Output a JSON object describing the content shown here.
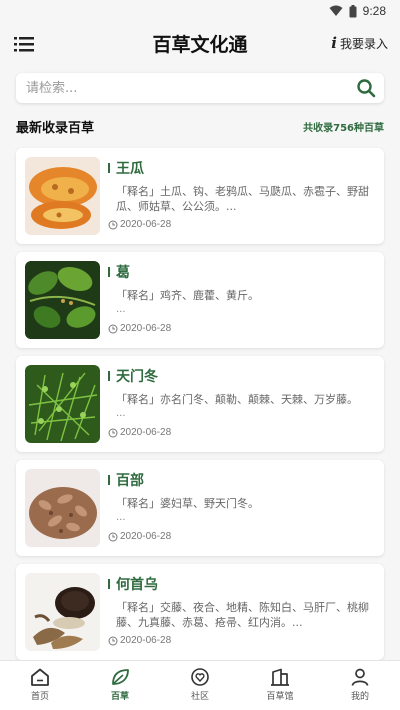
{
  "status_bar": {
    "time": "9:28"
  },
  "app_bar": {
    "title": "百草文化通",
    "contribute_label": "我要录入"
  },
  "search": {
    "placeholder": "请检索..."
  },
  "section": {
    "title": "最新收录百草",
    "count": "共收录756种百草"
  },
  "herbs": [
    {
      "name": "王瓜",
      "desc": "「释名」土瓜、钩、老鸦瓜、马瓞瓜、赤雹子、野甜瓜、师姑草、公公须。...",
      "more": "",
      "date": "2020-06-28",
      "image": "orange-gourd"
    },
    {
      "name": "葛",
      "desc": "「释名」鸡齐、鹿藿、黄斤。",
      "more": "...",
      "date": "2020-06-28",
      "image": "green-vine"
    },
    {
      "name": "天门冬",
      "desc": "「释名」亦名门冬、颠勒、颠棘、天棘、万岁藤。",
      "more": "...",
      "date": "2020-06-28",
      "image": "fern-foliage"
    },
    {
      "name": "百部",
      "desc": "「释名」婆妇草、野天门冬。",
      "more": "...",
      "date": "2020-06-28",
      "image": "dried-slices"
    },
    {
      "name": "何首乌",
      "desc": "「释名」交藤、夜合、地精、陈知白、马肝厂、桃柳藤、九真藤、赤葛、疮帚、红内消。...",
      "more": "",
      "date": "2020-06-28",
      "image": "dark-root"
    }
  ],
  "tabs": [
    {
      "label": "首页",
      "icon": "home-icon",
      "active": false
    },
    {
      "label": "百草",
      "icon": "leaf-icon",
      "active": true
    },
    {
      "label": "社区",
      "icon": "heart-icon",
      "active": false
    },
    {
      "label": "百草馆",
      "icon": "building-icon",
      "active": false
    },
    {
      "label": "我的",
      "icon": "person-icon",
      "active": false
    }
  ],
  "colors": {
    "accent": "#2f6b3f",
    "background": "#f6f6f6"
  }
}
